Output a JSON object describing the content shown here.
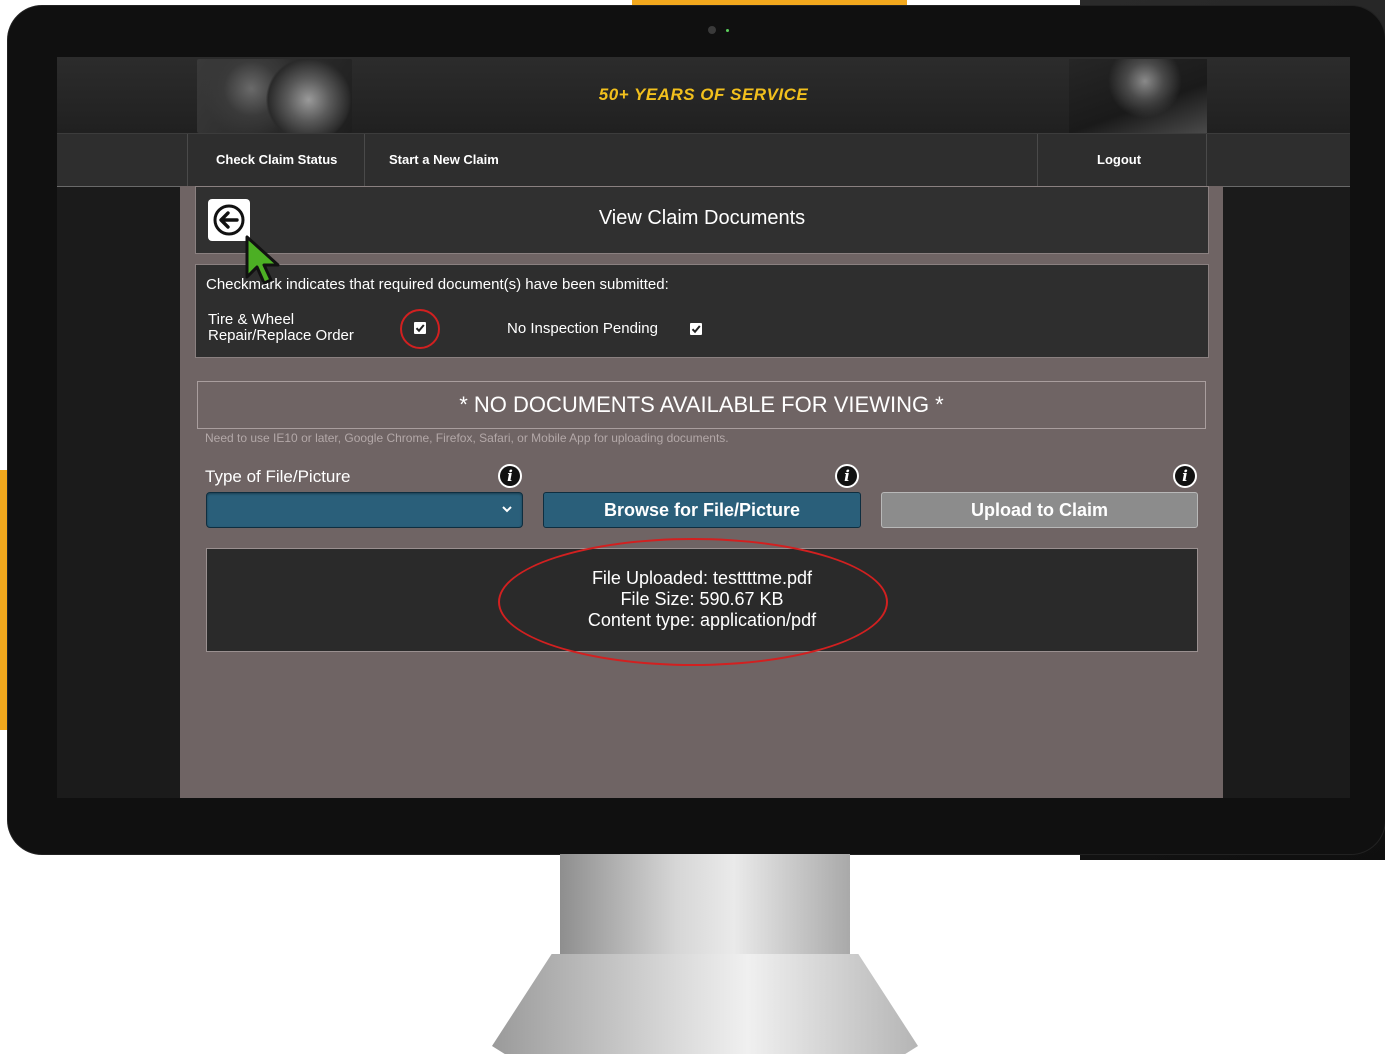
{
  "header": {
    "tagline": "50+ YEARS OF SERVICE"
  },
  "nav": {
    "items": [
      {
        "label": "Check Claim Status"
      },
      {
        "label": "Start a New Claim"
      }
    ],
    "logout_label": "Logout"
  },
  "page": {
    "title": "View Claim Documents"
  },
  "status": {
    "intro": "Checkmark indicates that required document(s) have been submitted:",
    "documents": [
      {
        "label_line1": "Tire & Wheel",
        "label_line2": "Repair/Replace Order",
        "checked": true
      },
      {
        "label": "No Inspection Pending",
        "checked": true
      }
    ]
  },
  "documents_panel": {
    "empty_message": "* NO DOCUMENTS AVAILABLE FOR VIEWING *",
    "browser_note": "Need to use IE10 or later, Google Chrome, Firefox, Safari, or Mobile App for uploading documents."
  },
  "upload": {
    "type_label": "Type of File/Picture",
    "type_selected": "",
    "browse_label": "Browse for File/Picture",
    "upload_label": "Upload to Claim",
    "info_glyph": "i"
  },
  "result": {
    "file_uploaded": "File Uploaded: testtttme.pdf",
    "file_size": "File Size: 590.67 KB",
    "content_type": "Content type: application/pdf"
  },
  "colors": {
    "accent_gold": "#f2c01d",
    "orange": "#f2a81d",
    "panel_bg": "#6f6464",
    "button_blue": "#2a5f7a",
    "button_gray": "#8c8c8c",
    "highlight_red": "#d22020",
    "cursor_green": "#4caf24"
  },
  "icons": {
    "back": "back-arrow-icon",
    "info": "info-icon",
    "check": "checkmark-icon",
    "chevron": "chevron-down-icon",
    "cursor": "mouse-pointer-icon"
  }
}
